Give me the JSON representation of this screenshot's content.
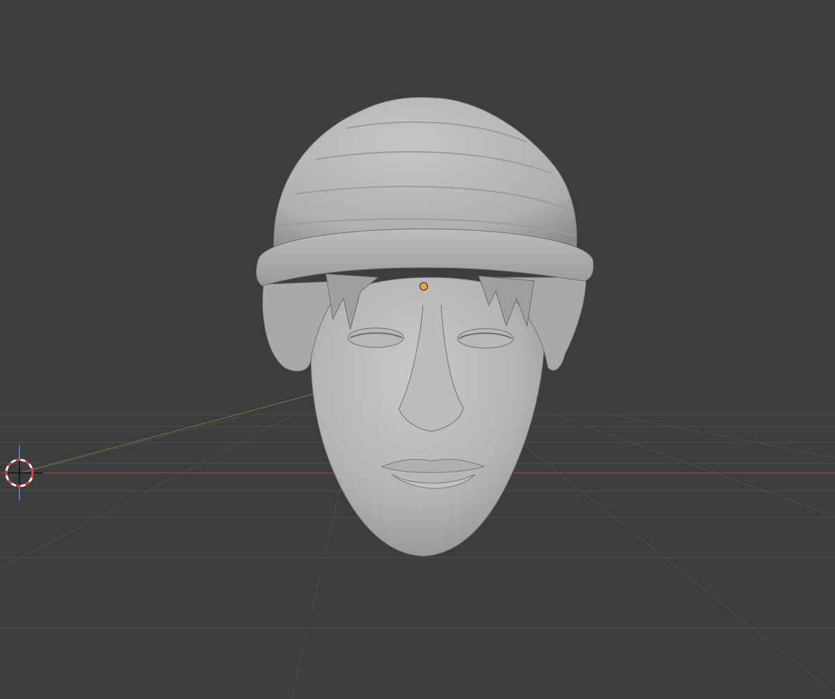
{
  "viewport": {
    "background": "#3d3d3d",
    "grid_color": "#4a4a4a",
    "x_axis_color": "#b34a4a",
    "y_axis_color": "#5d7a3a",
    "z_axis_color": "#4a78c8"
  },
  "scene": {
    "object": {
      "type": "mesh",
      "shape": "head-with-beanie",
      "shade_color": "#b8b8b8",
      "selected": true,
      "origin_color": "#f0a040"
    },
    "cursor": {
      "icon": "3d-cursor-icon",
      "ring_colors": [
        "#d23a3a",
        "#ffffff"
      ]
    }
  }
}
